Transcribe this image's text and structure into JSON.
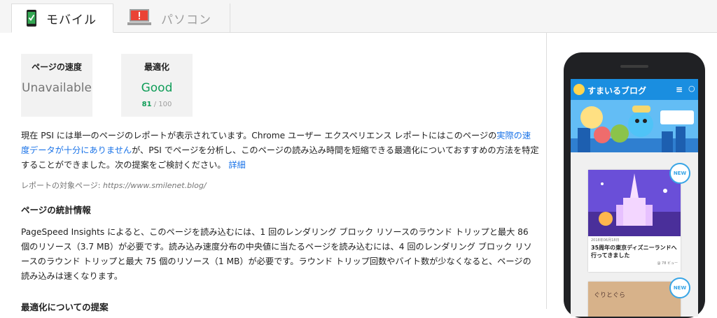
{
  "tabs": {
    "mobile": "モバイル",
    "desktop": "パソコン"
  },
  "cards": {
    "speed": {
      "title": "ページの速度",
      "value": "Unavailable"
    },
    "optimization": {
      "title": "最適化",
      "value": "Good",
      "score": "81",
      "score_max": "/ 100"
    }
  },
  "report": {
    "text_before_link": "現在 PSI には単一のページのレポートが表示されています。Chrome ユーザー エクスペリエンス レポートにはこのページの",
    "link_insufficient": "実際の速度データが十分にありません",
    "text_after_link": "が、PSI でページを分析し、このページの読み込み時間を短縮できる最適化についておすすめの方法を特定することができました。次の提案をご検討ください。",
    "link_details": "詳細",
    "target_label": "レポートの対象ページ:",
    "target_url": "https://www.smilenet.blog/"
  },
  "stats": {
    "heading": "ページの統計情報",
    "text": "PageSpeed Insights によると、このページを読み込むには、1 回のレンダリング ブロック リソースのラウンド トリップと最大 86 個のリソース（3.7 MB）が必要です。読み込み速度分布の中央値に当たるページを読み込むには、4 回のレンダリング ブロック リソースのラウンド トリップと最大 75 個のリソース（1 MB）が必要です。ラウンド トリップ回数やバイト数が少なくなると、ページの読み込みは速くなります。"
  },
  "optimization_heading": "最適化についての提案",
  "preview": {
    "site_title": "すまいるブログ",
    "post1_date": "2018年06月18日",
    "post1_title": "35周年の東京ディズニーランドへ行ってきました",
    "post1_meta": "@ 78 ビュー",
    "badge": "NEW",
    "post2_text": "ぐりとぐら"
  },
  "colors": {
    "good": "#0f9d58",
    "link": "#1a73e8",
    "site_blue": "#1a8ee0"
  }
}
